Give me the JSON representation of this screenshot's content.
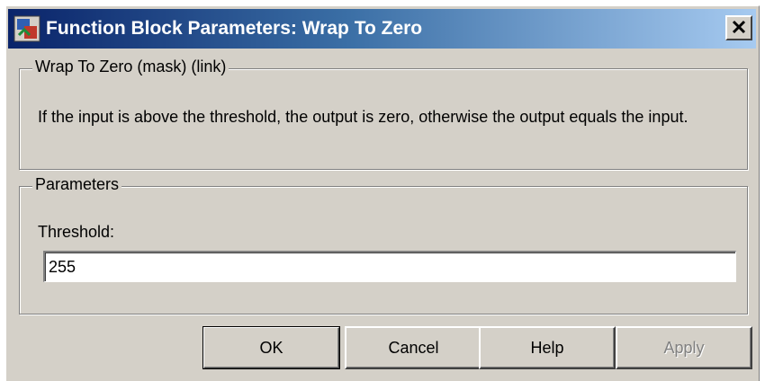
{
  "window": {
    "title": "Function Block Parameters: Wrap To Zero",
    "close_label": "✕"
  },
  "description_group": {
    "legend": "Wrap To Zero (mask) (link)",
    "text": "If the input is above the threshold, the output is zero, otherwise the output equals the input."
  },
  "parameters_group": {
    "legend": "Parameters",
    "threshold_label": "Threshold:",
    "threshold_value": "255"
  },
  "buttons": {
    "ok": "OK",
    "cancel": "Cancel",
    "help": "Help",
    "apply": "Apply"
  },
  "icons": {
    "app": "simulink-block-icon",
    "close": "close-icon"
  }
}
